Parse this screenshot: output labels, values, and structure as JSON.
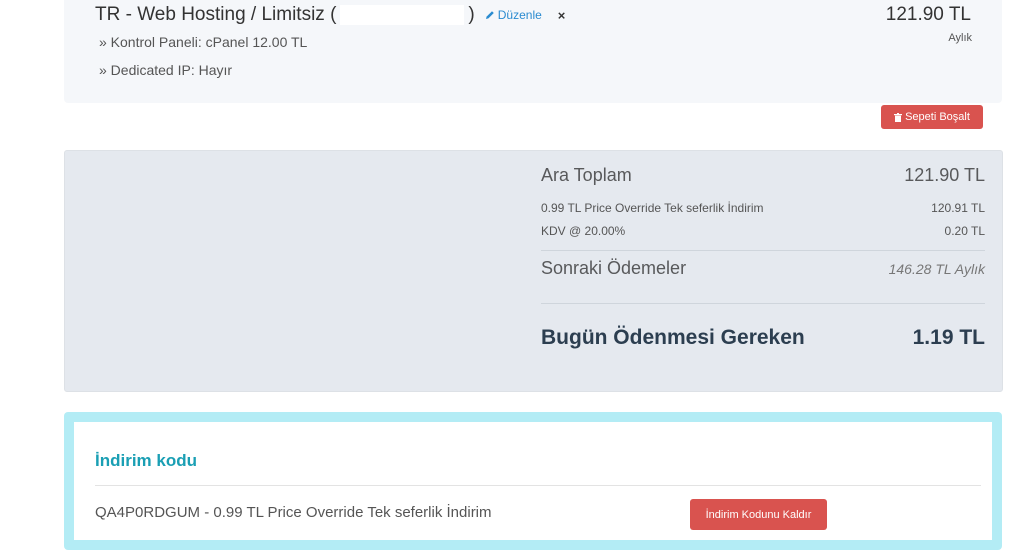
{
  "product": {
    "title_prefix": "TR - Web Hosting / Limitsiz (",
    "title_suffix": ")",
    "edit_label": "Düzenle",
    "remove_icon": "×",
    "options": [
      "» Kontrol Paneli: cPanel 12.00 TL",
      "» Dedicated IP: Hayır"
    ],
    "price": "121.90 TL",
    "billing_cycle": "Aylık"
  },
  "empty_cart_label": "Sepeti Boşalt",
  "summary": {
    "subtotal_label": "Ara Toplam",
    "subtotal_value": "121.90 TL",
    "discount_label": "0.99 TL Price Override Tek seferlik İndirim",
    "discount_value": "120.91 TL",
    "tax_label": "KDV @ 20.00%",
    "tax_value": "0.20 TL",
    "recurring_label": "Sonraki Ödemeler",
    "recurring_value": "146.28 TL Aylık",
    "total_label": "Bugün Ödenmesi Gereken",
    "total_value": "1.19 TL"
  },
  "promo": {
    "title": "İndirim kodu",
    "applied_text": "QA4P0RDGUM - 0.99 TL Price Override Tek seferlik İndirim",
    "remove_button": "İndirim Kodunu Kaldır"
  },
  "colors": {
    "accent": "#1a9fb4",
    "danger": "#d9534f",
    "link": "#2a8bd0",
    "promo_border": "#b3ecf5"
  },
  "icons": {
    "edit": "pencil-icon",
    "remove": "close-icon",
    "empty_cart": "trash-icon"
  }
}
